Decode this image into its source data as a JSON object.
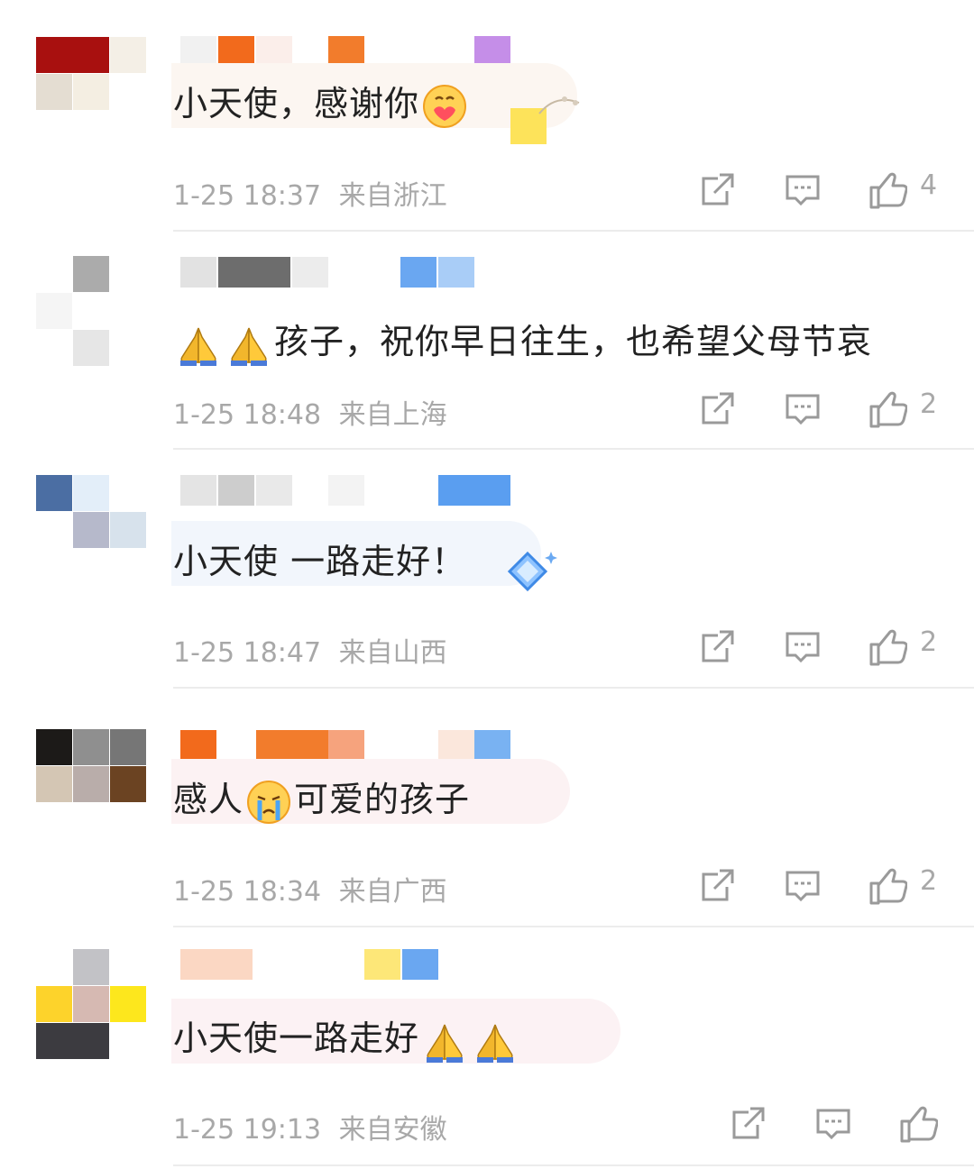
{
  "comments": [
    {
      "text": "小天使，感谢你",
      "time": "1-25 18:37",
      "location": "来自浙江",
      "likes": "4",
      "emoji": "hugging-heart-icon"
    },
    {
      "text": "孩子，祝你早日往生，也希望父母节哀",
      "time": "1-25 18:48",
      "location": "来自上海",
      "likes": "2",
      "emoji": "praying-hands-icon"
    },
    {
      "text": "小天使 一路走好！",
      "time": "1-25 18:47",
      "location": "来自山西",
      "likes": "2",
      "emoji": "diamond-sticker-icon"
    },
    {
      "text_before": "感人",
      "text_after": "可爱的孩子",
      "time": "1-25 18:34",
      "location": "来自广西",
      "likes": "2",
      "emoji": "crying-face-icon"
    },
    {
      "text": "小天使一路走好",
      "time": "1-25 19:13",
      "location": "来自安徽",
      "likes": "",
      "emoji": "praying-hands-icon"
    }
  ],
  "icons": {
    "share": "share-icon",
    "reply": "reply-icon",
    "like": "thumbs-up-icon"
  },
  "colors": {
    "meta": "#a8a8a8",
    "divider": "#ececec",
    "text": "#222222"
  }
}
